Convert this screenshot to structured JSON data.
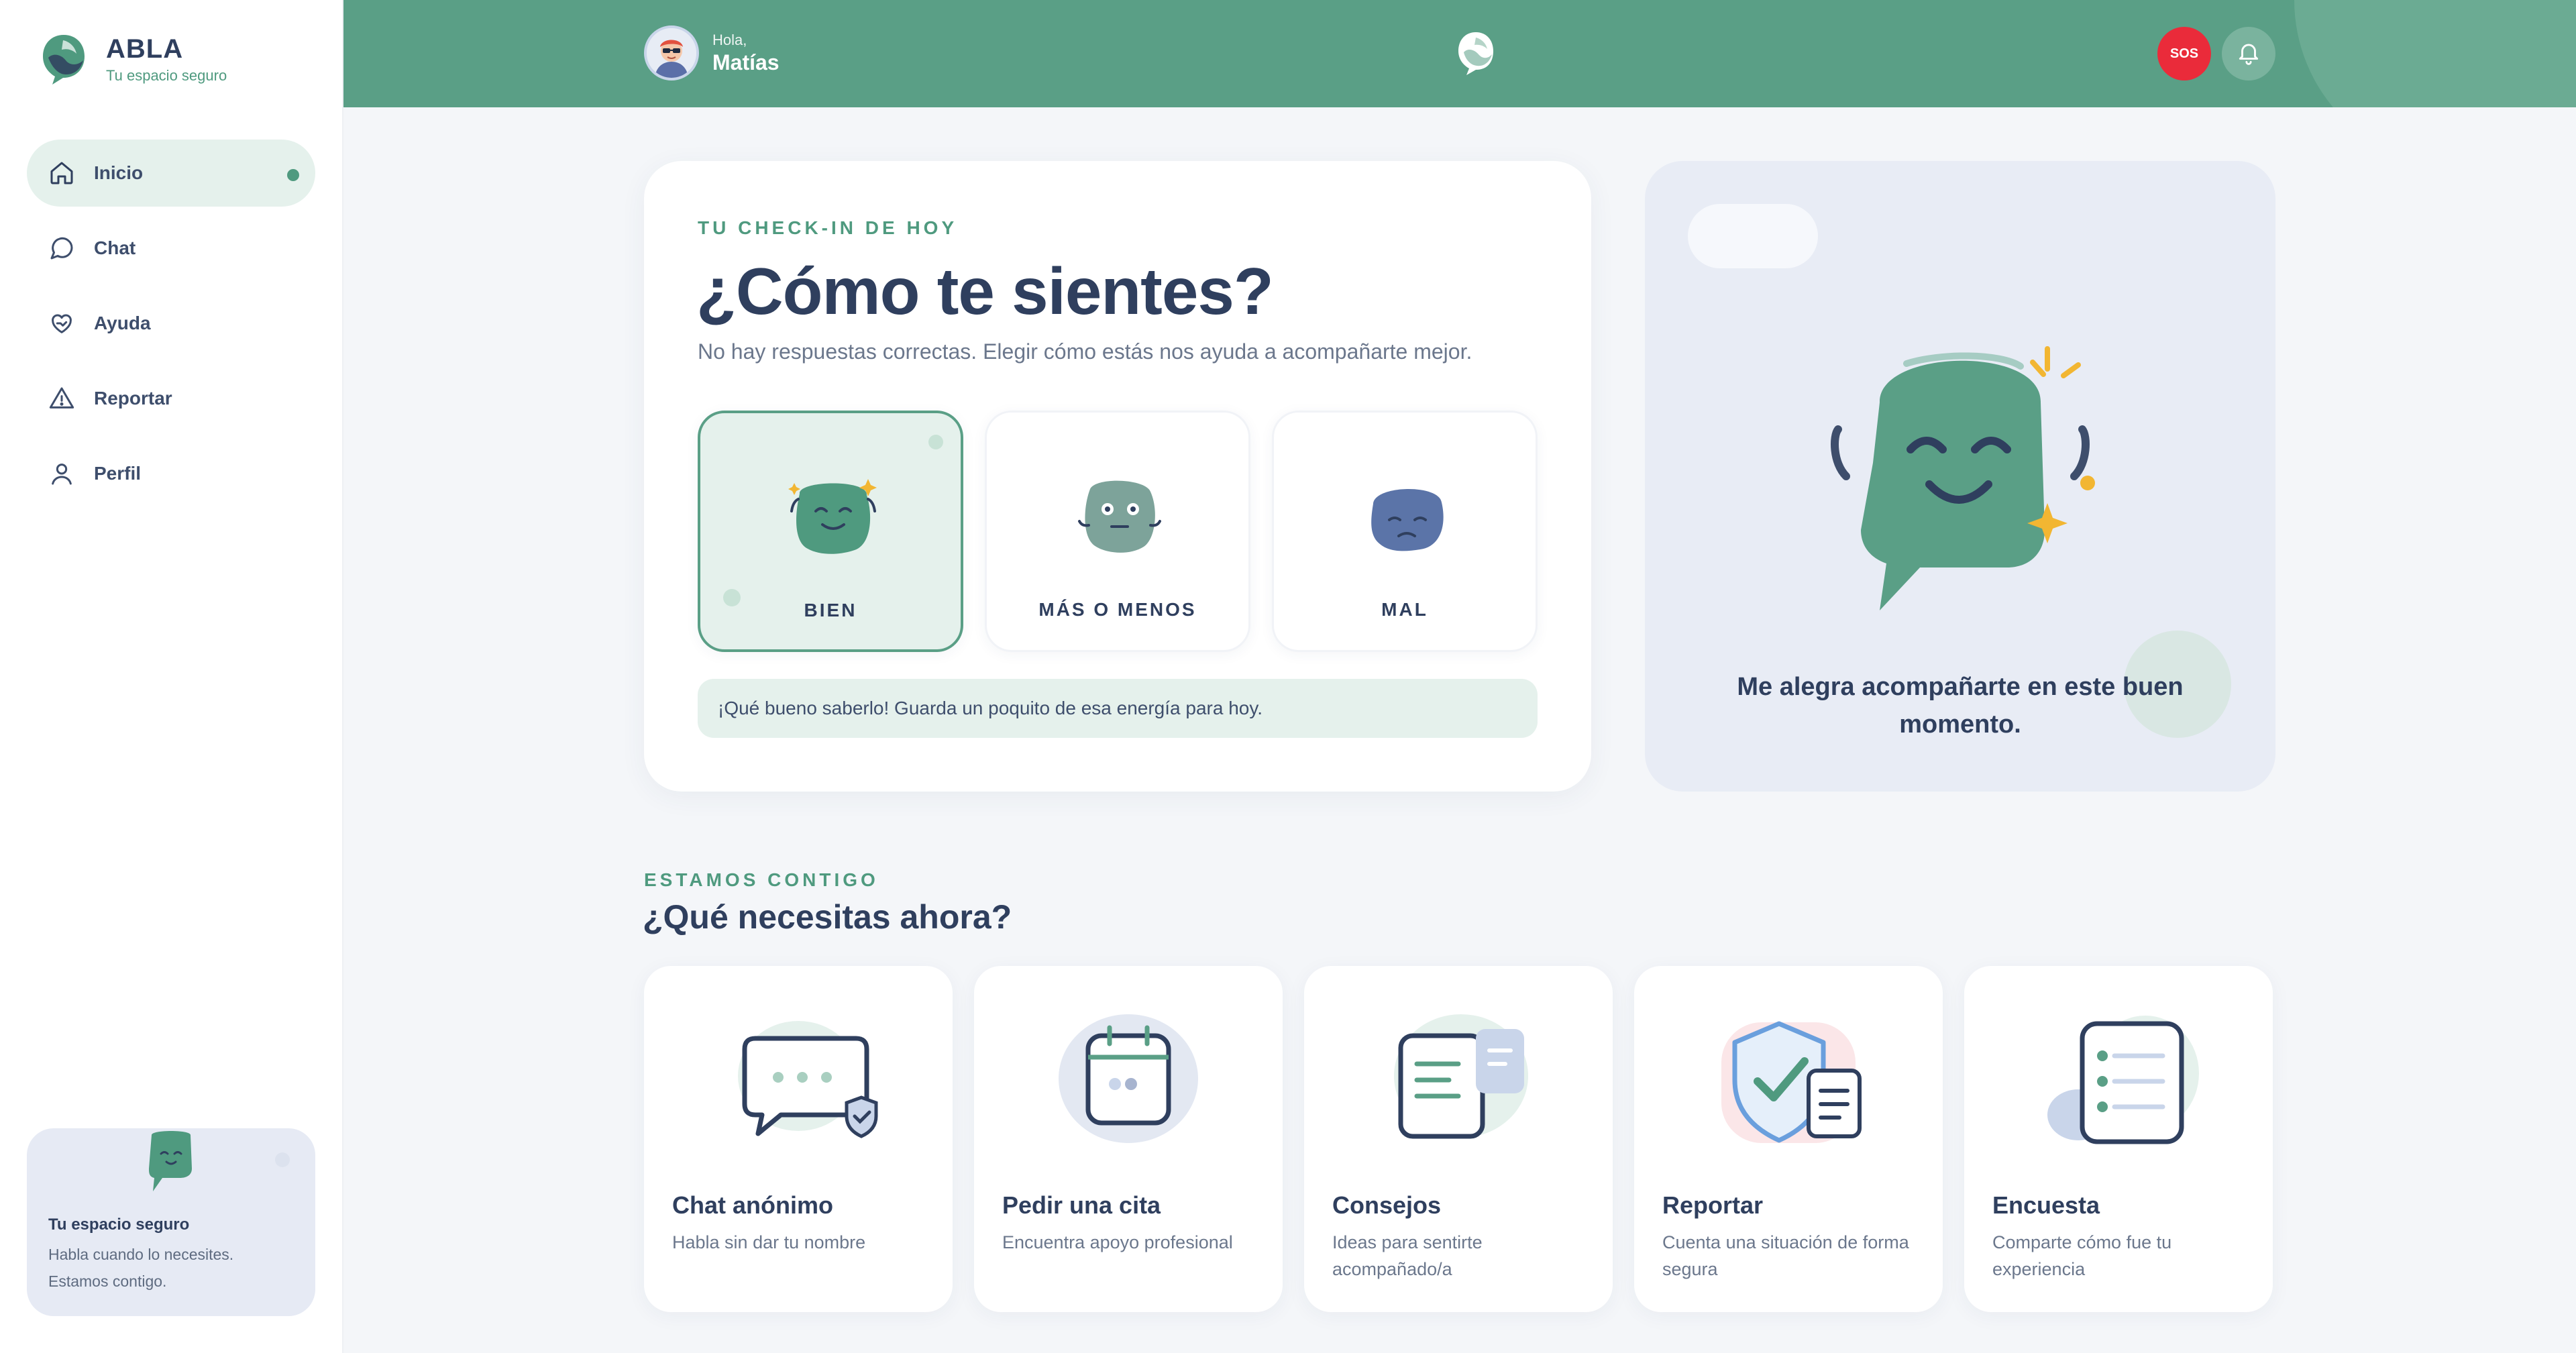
{
  "brand": {
    "name": "ABLA",
    "tagline": "Tu espacio seguro"
  },
  "sidebar": {
    "items": [
      {
        "label": "Inicio",
        "icon": "home-icon",
        "active": true
      },
      {
        "label": "Chat",
        "icon": "chat-icon"
      },
      {
        "label": "Ayuda",
        "icon": "heart-hand-icon"
      },
      {
        "label": "Reportar",
        "icon": "warning-icon"
      },
      {
        "label": "Perfil",
        "icon": "user-icon"
      }
    ],
    "safe_card": {
      "title": "Tu espacio seguro",
      "text": "Habla cuando lo necesites. Estamos contigo."
    }
  },
  "header": {
    "greeting": "Hola,",
    "user_name": "Matías",
    "sos_label": "SOS",
    "icons": [
      "avatar",
      "abla-logo-icon",
      "bell-icon"
    ]
  },
  "checkin": {
    "eyebrow": "TU CHECK-IN DE HOY",
    "title": "¿Cómo te sientes?",
    "subtitle": "No hay respuestas correctas. Elegir cómo estás nos ayuda a acompañarte mejor.",
    "moods": [
      {
        "label": "BIEN",
        "selected": true
      },
      {
        "label": "MÁS O MENOS",
        "selected": false
      },
      {
        "label": "MAL",
        "selected": false
      }
    ],
    "feedback": "¡Qué bueno saberlo! Guarda un poquito de esa energía para hoy."
  },
  "illustration": {
    "message": "Me alegra acompañarte en este buen momento."
  },
  "needs": {
    "eyebrow": "ESTAMOS CONTIGO",
    "title": "¿Qué necesitas ahora?",
    "actions": [
      {
        "title": "Chat anónimo",
        "desc": "Habla sin dar tu nombre",
        "icon": "anonymous-chat-icon"
      },
      {
        "title": "Pedir una cita",
        "desc": "Encuentra apoyo profesional",
        "icon": "calendar-icon"
      },
      {
        "title": "Consejos",
        "desc": "Ideas para sentirte acompañado/a",
        "icon": "tips-document-icon"
      },
      {
        "title": "Reportar",
        "desc": "Cuenta una situación de forma segura",
        "icon": "shield-check-icon"
      },
      {
        "title": "Encuesta",
        "desc": "Comparte cómo fue tu experiencia",
        "icon": "survey-list-icon"
      }
    ]
  },
  "colors": {
    "primary": "#5a9f86",
    "navy": "#2f3f5e",
    "sos": "#ea2b3a",
    "mint_bg": "#e5f1ec",
    "lavender_bg": "#e8ecf5"
  }
}
